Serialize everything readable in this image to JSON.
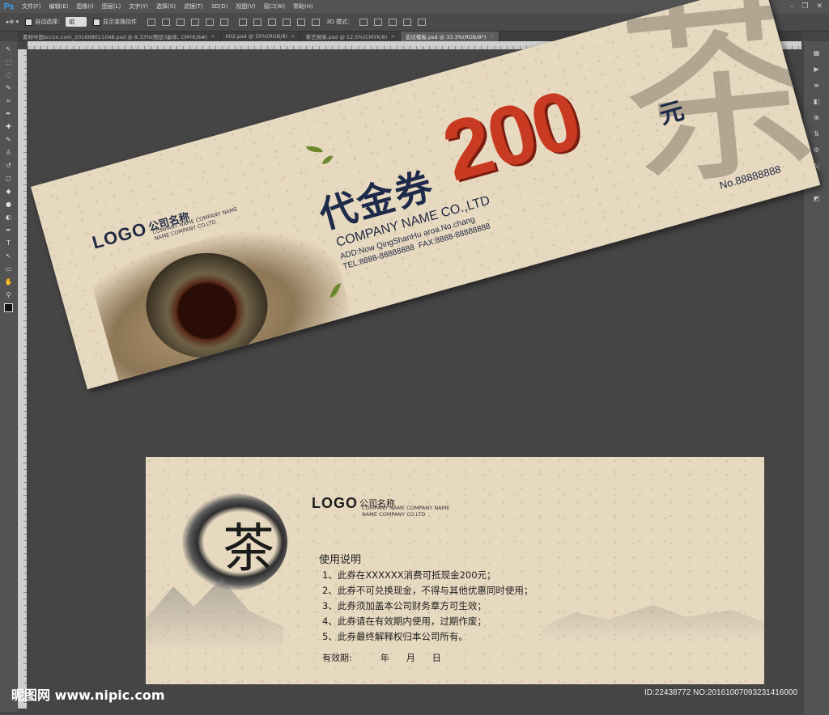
{
  "app": {
    "logo": "Ps",
    "menu": [
      "文件(F)",
      "编辑(E)",
      "图像(I)",
      "图层(L)",
      "文字(Y)",
      "选择(S)",
      "滤镜(T)",
      "3D(D)",
      "视图(V)",
      "窗口(W)",
      "帮助(H)"
    ],
    "window_controls": [
      "–",
      "❐",
      "✕"
    ]
  },
  "options_bar": {
    "auto_select_label": "自动选择：",
    "auto_select_value": "组",
    "show_transform_label": "显示变换控件",
    "mode_3d_label": "3D 模式："
  },
  "tabs": [
    {
      "label": "素材中国sccnn.com_201608011048.psd @ 8.33%(图层3副本, CMYK/8#)",
      "active": false
    },
    {
      "label": "002.psd @ 50%(RGB/8)",
      "active": false
    },
    {
      "label": "茶艺展架.psd @ 12.5%(CMYK/8)",
      "active": false
    },
    {
      "label": "会议模板.psd @ 33.3%(RGB/8*)",
      "active": true
    }
  ],
  "tools": [
    "move-tool-icon",
    "marquee-tool-icon",
    "lasso-tool-icon",
    "quick-select-icon",
    "crop-tool-icon",
    "eyedropper-icon",
    "healing-brush-icon",
    "brush-tool-icon",
    "clone-stamp-icon",
    "history-brush-icon",
    "eraser-icon",
    "paint-bucket-icon",
    "blur-tool-icon",
    "dodge-tool-icon",
    "pen-tool-icon",
    "type-tool-icon",
    "path-select-icon",
    "shape-tool-icon",
    "hand-tool-icon",
    "zoom-tool-icon"
  ],
  "tool_glyphs": [
    "↖",
    "⬚",
    "◌",
    "✎",
    "⌗",
    "✒",
    "✚",
    "✎",
    "♙",
    "↺",
    "◻",
    "◆",
    "●",
    "◐",
    "✒",
    "T",
    "↖",
    "▭",
    "✋",
    "⚲"
  ],
  "right_panel_glyphs": [
    "▦",
    "▶",
    "≡",
    "◧",
    "⊞",
    "⇅",
    "⚙",
    "A|",
    "¶",
    "◩"
  ],
  "front": {
    "logo_word": "LOGO",
    "logo_cn": "公司名称",
    "logo_sub_1": "COMPANY NAME COMPANY NAME",
    "logo_sub_2": "NAME COMPANY CO.LTD",
    "title": "代金券",
    "amount": "200",
    "unit": "元",
    "brush_char": "茶",
    "company": "COMPANY NAME CO.,LTD",
    "address": "ADD:Now QingShanHu aroa.No.chang",
    "fax": "FAX:8888-88888888",
    "tel": "TEL:8888-88888888",
    "serial": "No.88888888"
  },
  "back": {
    "logo_word": "LOGO",
    "logo_cn": "公司名称",
    "logo_sub_1": "COMPANY NAME COMPANY NAME",
    "logo_sub_2": "NAME COMPANY CO.LTD",
    "brush_char": "茶",
    "instructions_title": "使用说明",
    "rules": [
      "1、此券在XXXXXX消费可抵现金200元；",
      "2、此券不可兑换现金，不得与其他优惠同时使用；",
      "3、此券须加盖本公司财务章方可生效；",
      "4、此券请在有效期内使用，过期作废；",
      "5、此券最终解释权归本公司所有。"
    ],
    "validity_label": "有效期:",
    "year": "年",
    "month": "月",
    "day": "日"
  },
  "watermark": "昵图网 www.nipic.com",
  "image_id": "ID:22438772 NO:20161007093231416000"
}
